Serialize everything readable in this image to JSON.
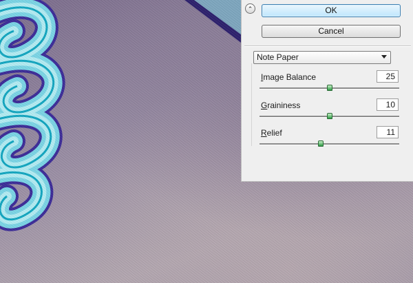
{
  "dialog": {
    "ok_label": "OK",
    "cancel_label": "Cancel",
    "collapse_glyph": "⌃"
  },
  "filter": {
    "selected": "Note Paper"
  },
  "params": [
    {
      "prefix": "",
      "underlined": "I",
      "rest": "mage Balance",
      "value": "25",
      "fraction": 0.5
    },
    {
      "prefix": "",
      "underlined": "G",
      "rest": "raininess",
      "value": "10",
      "fraction": 0.5
    },
    {
      "prefix": "",
      "underlined": "R",
      "rest": "elief",
      "value": "11",
      "fraction": 0.44
    }
  ],
  "colors": {
    "accent_thumb": "#2e9b45",
    "loop_fill": "#9fe8f3",
    "loop_stroke": "#10b9cf",
    "loop_outline": "#3b2a9a"
  }
}
